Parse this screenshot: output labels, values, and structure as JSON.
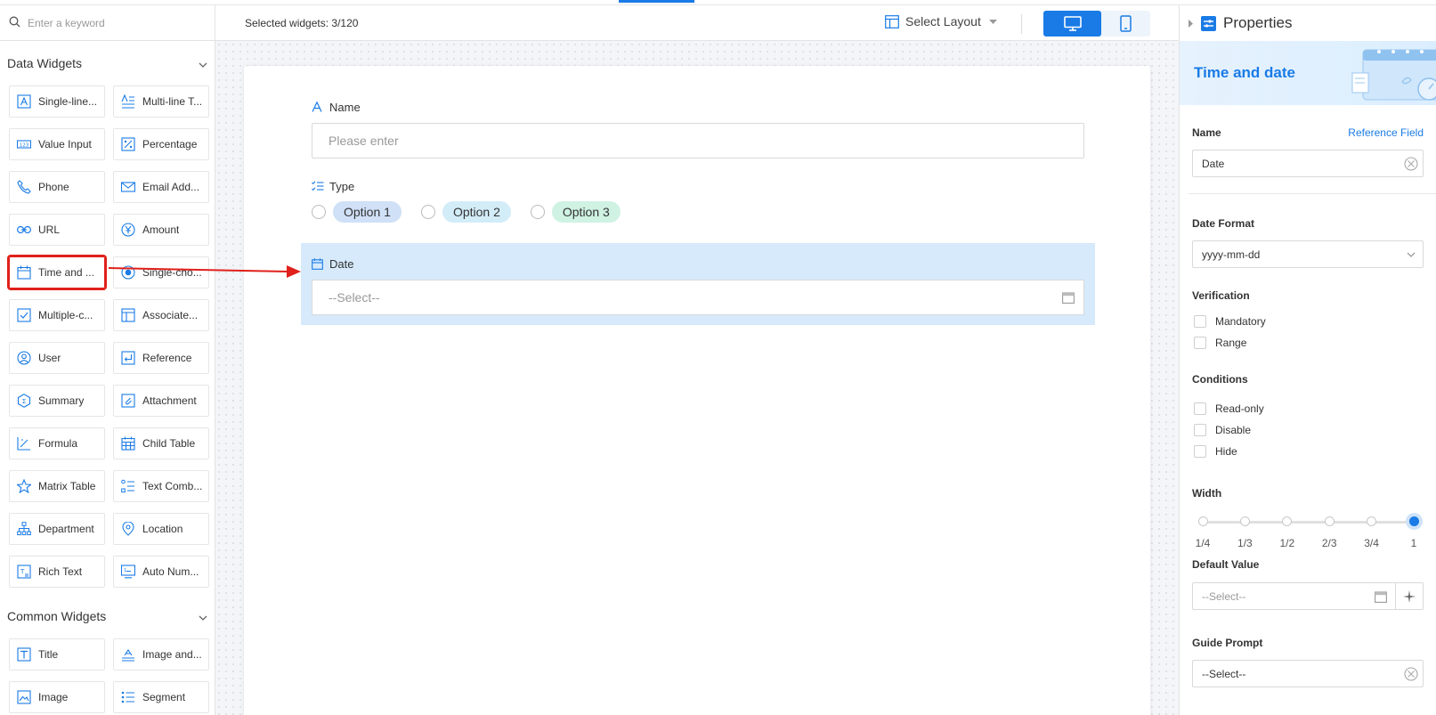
{
  "search": {
    "placeholder": "Enter a keyword"
  },
  "groups": {
    "data_widgets": "Data Widgets",
    "common_widgets": "Common Widgets"
  },
  "data_widgets": [
    {
      "label": "Single-line...",
      "icon": "single-line-text-icon"
    },
    {
      "label": "Multi-line T...",
      "icon": "multi-line-text-icon"
    },
    {
      "label": "Value Input",
      "icon": "value-input-icon"
    },
    {
      "label": "Percentage",
      "icon": "percentage-icon"
    },
    {
      "label": "Phone",
      "icon": "phone-icon"
    },
    {
      "label": "Email Add...",
      "icon": "email-icon"
    },
    {
      "label": "URL",
      "icon": "link-icon"
    },
    {
      "label": "Amount",
      "icon": "yen-icon"
    },
    {
      "label": "Time and ...",
      "icon": "calendar-icon"
    },
    {
      "label": "Single-cho...",
      "icon": "radio-icon"
    },
    {
      "label": "Multiple-c...",
      "icon": "checkbox-icon"
    },
    {
      "label": "Associate...",
      "icon": "associate-icon"
    },
    {
      "label": "User",
      "icon": "user-icon"
    },
    {
      "label": "Reference",
      "icon": "reference-icon"
    },
    {
      "label": "Summary",
      "icon": "summary-icon"
    },
    {
      "label": "Attachment",
      "icon": "paperclip-icon"
    },
    {
      "label": "Formula",
      "icon": "formula-icon"
    },
    {
      "label": "Child Table",
      "icon": "child-table-icon"
    },
    {
      "label": "Matrix Table",
      "icon": "star-icon"
    },
    {
      "label": "Text Comb...",
      "icon": "text-combination-icon"
    },
    {
      "label": "Department",
      "icon": "department-icon"
    },
    {
      "label": "Location",
      "icon": "location-pin-icon"
    },
    {
      "label": "Rich Text",
      "icon": "rich-text-icon"
    },
    {
      "label": "Auto Num...",
      "icon": "auto-number-icon"
    }
  ],
  "common_widgets": [
    {
      "label": "Title",
      "icon": "title-icon"
    },
    {
      "label": "Image and...",
      "icon": "image-text-icon"
    },
    {
      "label": "Image",
      "icon": "image-icon"
    },
    {
      "label": "Segment",
      "icon": "segment-icon"
    }
  ],
  "toolbar": {
    "selected": "Selected widgets: 3/120",
    "layout": "Select Layout"
  },
  "form": {
    "name_label": "Name",
    "name_placeholder": "Please enter",
    "type_label": "Type",
    "options": [
      {
        "label": "Option 1",
        "color": "#cfe0f7"
      },
      {
        "label": "Option 2",
        "color": "#d3edf8"
      },
      {
        "label": "Option 3",
        "color": "#cff2e3"
      }
    ],
    "date_label": "Date",
    "date_placeholder": "--Select--"
  },
  "properties": {
    "title": "Properties",
    "banner": "Time and date",
    "name_label": "Name",
    "reference_field": "Reference Field",
    "name_value": "Date",
    "date_format_label": "Date Format",
    "date_format_value": "yyyy-mm-dd",
    "verification_label": "Verification",
    "verification": [
      "Mandatory",
      "Range"
    ],
    "conditions_label": "Conditions",
    "conditions": [
      "Read-only",
      "Disable",
      "Hide"
    ],
    "width_label": "Width",
    "width_ticks": [
      "1/4",
      "1/3",
      "1/2",
      "2/3",
      "3/4",
      "1"
    ],
    "width_selected": "1",
    "default_value_label": "Default Value",
    "default_value_placeholder": "--Select--",
    "guide_prompt_label": "Guide Prompt",
    "guide_prompt_value": "--Select--"
  },
  "colors": {
    "accent": "#1a7be6",
    "highlight": "#e0201b"
  }
}
